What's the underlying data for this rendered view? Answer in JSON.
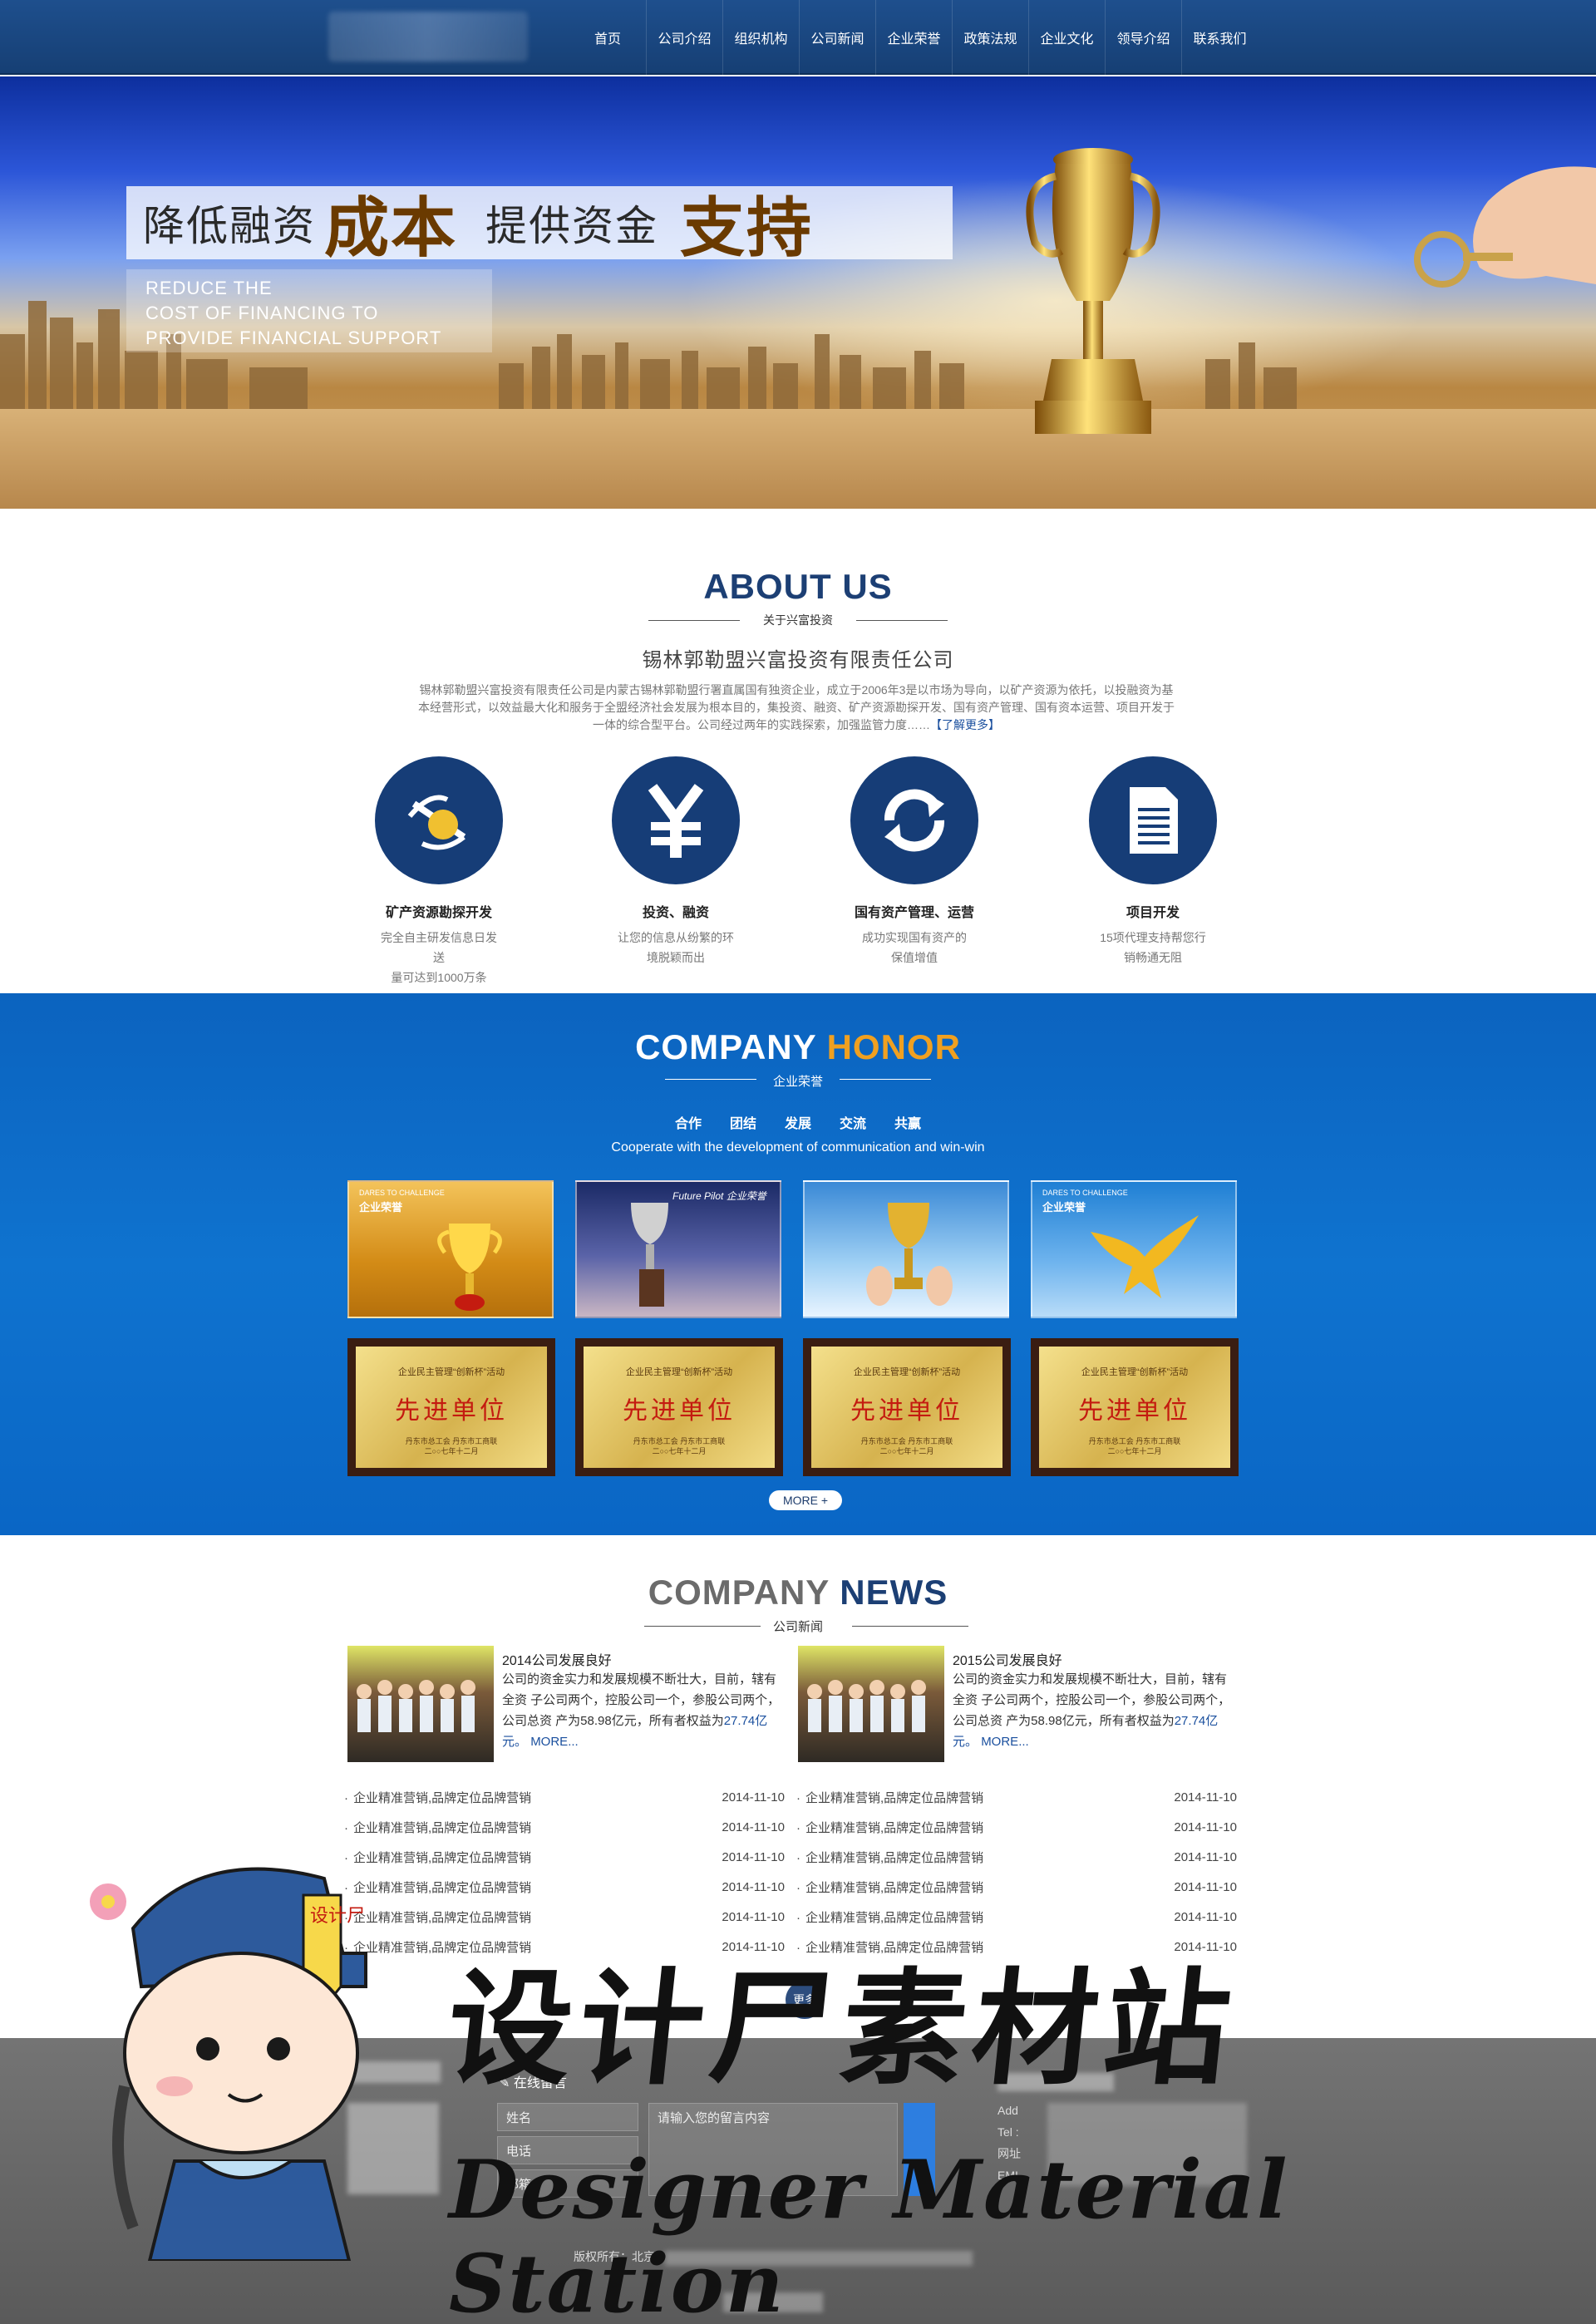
{
  "nav": {
    "items": [
      "首页",
      "公司介绍",
      "组织机构",
      "公司新闻",
      "企业荣誉",
      "政策法规",
      "企业文化",
      "领导介绍",
      "联系我们"
    ]
  },
  "banner": {
    "slogan_part1": "降低融资",
    "slogan_part2": "成本",
    "slogan_part3": "提供资金",
    "slogan_part4": "支持",
    "sub_line1": "REDUCE THE",
    "sub_line2": "COST OF FINANCING TO",
    "sub_line3": "PROVIDE FINANCIAL SUPPORT"
  },
  "about": {
    "title": "ABOUT US",
    "subtitle": "关于兴富投资",
    "company": "锡林郭勒盟兴富投资有限责任公司",
    "intro": "锡林郭勒盟兴富投资有限责任公司是内蒙古锡林郭勒盟行署直属国有独资企业，成立于2006年3是以市场为导向，以矿产资源为依托，以投融资为基本经营形式，以效益最大化和服务于全盟经济社会发展为根本目的，集投资、融资、矿产资源勘探开发、国有资产管理、国有资本运营、项目开发于一体的综合型平台。公司经过两年的实践探索，加强监管力度……",
    "more": "【了解更多】",
    "services": [
      {
        "icon": "mining-icon",
        "title": "矿产资源勘探开发",
        "desc1": "完全自主研发信息日发",
        "desc2": "送",
        "desc3": "量可达到1000万条"
      },
      {
        "icon": "yen-icon",
        "title": "投资、融资",
        "desc1": "让您的信息从纷繁的环",
        "desc2": "境脱颖而出",
        "desc3": ""
      },
      {
        "icon": "refresh-icon",
        "title": "国有资产管理、运营",
        "desc1": "成功实现国有资产的",
        "desc2": "保值增值",
        "desc3": ""
      },
      {
        "icon": "document-icon",
        "title": "项目开发",
        "desc1": "15项代理支持帮您行",
        "desc2": "销畅通无阻",
        "desc3": ""
      }
    ]
  },
  "honor": {
    "title_a": "COMPANY ",
    "title_b": "HONOR",
    "subtitle": "企业荣誉",
    "tags": [
      "合作",
      "团结",
      "发展",
      "交流",
      "共赢"
    ],
    "en": "Cooperate with the development of communication and win-win",
    "photos": [
      {
        "label_a": "DARES TO CHALLENGE",
        "label_b": "企业荣誉"
      },
      {
        "label_a": "Future Pilot",
        "label_b": "企业荣誉"
      },
      {
        "label_a": "",
        "label_b": ""
      },
      {
        "label_a": "DARES TO CHALLENGE",
        "label_b": "企业荣誉"
      }
    ],
    "plaque": {
      "top": "企业民主管理“创新杯”活动",
      "big": "先进单位",
      "bot1": "丹东市总工会  丹东市工商联",
      "bot2": "二○○七年十二月"
    },
    "more": "MORE +"
  },
  "news": {
    "title_a": "COMPANY ",
    "title_b": "NEWS",
    "subtitle": "公司新闻",
    "features": [
      {
        "title": "2014公司发展良好",
        "body": "公司的资金实力和发展规模不断壮大，目前，辖有全资 子公司两个，控股公司一个，参股公司两个，公司总资 产为58.98亿元，所有者权益为",
        "tail": "27.74亿元。",
        "more": "MORE..."
      },
      {
        "title": "2015公司发展良好",
        "body": "公司的资金实力和发展规模不断壮大，目前，辖有全资 子公司两个，控股公司一个，参股公司两个，公司总资 产为58.98亿元，所有者权益为",
        "tail": "27.74亿元。",
        "more": "MORE..."
      }
    ],
    "list_left": [
      {
        "text": "企业精准营销,品牌定位品牌营销",
        "date": "2014-11-10"
      },
      {
        "text": "企业精准营销,品牌定位品牌营销",
        "date": "2014-11-10"
      },
      {
        "text": "企业精准营销,品牌定位品牌营销",
        "date": "2014-11-10"
      },
      {
        "text": "企业精准营销,品牌定位品牌营销",
        "date": "2014-11-10"
      },
      {
        "text": "企业精准营销,品牌定位品牌营销",
        "date": "2014-11-10"
      },
      {
        "text": "企业精准营销,品牌定位品牌营销",
        "date": "2014-11-10"
      }
    ],
    "list_right": [
      {
        "text": "企业精准营销,品牌定位品牌营销",
        "date": "2014-11-10"
      },
      {
        "text": "企业精准营销,品牌定位品牌营销",
        "date": "2014-11-10"
      },
      {
        "text": "企业精准营销,品牌定位品牌营销",
        "date": "2014-11-10"
      },
      {
        "text": "企业精准营销,品牌定位品牌营销",
        "date": "2014-11-10"
      },
      {
        "text": "企业精准营销,品牌定位品牌营销",
        "date": "2014-11-10"
      },
      {
        "text": "企业精准营销,品牌定位品牌营销",
        "date": "2014-11-10"
      }
    ],
    "more": "更多"
  },
  "footer": {
    "message_title": "在线留言",
    "name_placeholder": "姓名",
    "phone_placeholder": "电话",
    "email_placeholder": "邮箱",
    "content_placeholder": "请输入您的留言内容",
    "contact_add": "Add",
    "contact_tel": "Tel :",
    "contact_web": "网址",
    "contact_email": "EMI",
    "copyright": "版权所有：北京"
  },
  "watermark": {
    "cn": "设计尸素材站",
    "en": "Designer Material Station",
    "badge": "设计尸"
  }
}
